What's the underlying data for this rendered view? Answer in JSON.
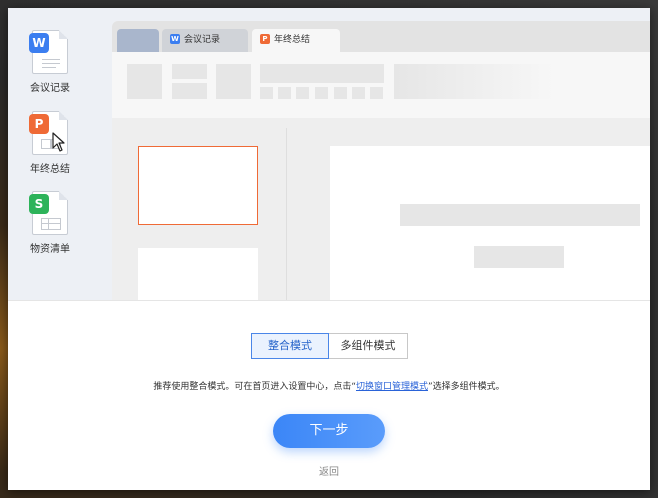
{
  "desktop": {
    "icons": [
      {
        "label": "会议记录",
        "badge": "W",
        "color": "#3b7ef0",
        "icon": "writer-doc-icon"
      },
      {
        "label": "年终总结",
        "badge": "P",
        "color": "#ef6a36",
        "icon": "presentation-doc-icon"
      },
      {
        "label": "物资清单",
        "badge": "S",
        "color": "#2db35a",
        "icon": "spreadsheet-doc-icon"
      }
    ]
  },
  "app": {
    "tabs": [
      {
        "label": "会议记录",
        "badge": "W",
        "color": "#3b7ef0"
      },
      {
        "label": "年终总结",
        "badge": "P",
        "color": "#ef6a36"
      }
    ]
  },
  "modes": {
    "integrated": "整合模式",
    "multi": "多组件模式",
    "selected": "整合模式"
  },
  "hint": {
    "before": "推荐使用整合模式。可在首页进入设置中心，点击“",
    "link": "切换窗口管理模式",
    "after": "”选择多组件模式。"
  },
  "actions": {
    "next": "下一步",
    "back": "返回"
  },
  "colors": {
    "accent": "#3b86f7",
    "selected_slide_border": "#ef6a36"
  }
}
